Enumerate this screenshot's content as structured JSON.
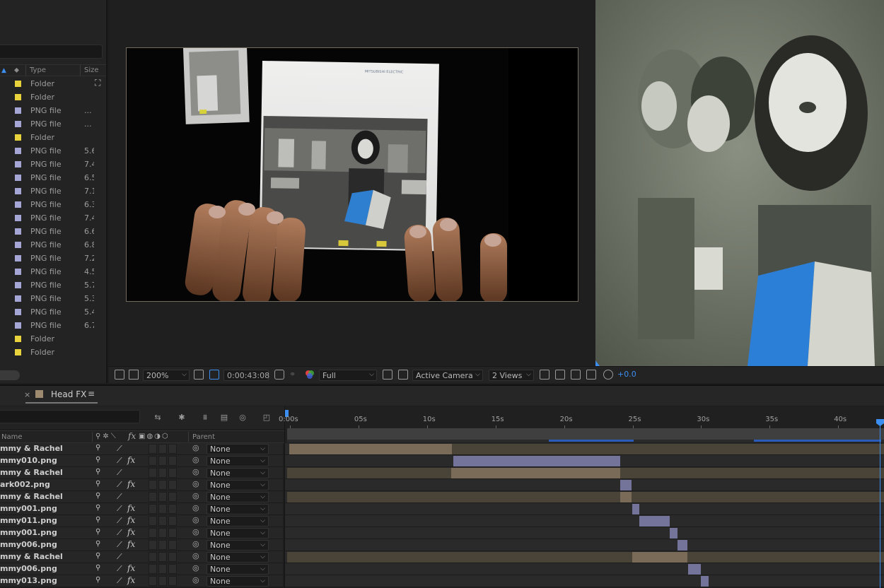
{
  "project": {
    "columns": {
      "type": "Type",
      "size": "Size"
    },
    "items": [
      {
        "type": "Folder",
        "size": "",
        "color": "#e8d33d"
      },
      {
        "type": "Folder",
        "size": "",
        "color": "#e8d33d"
      },
      {
        "type": "PNG file",
        "size": "...",
        "color": "#a6a6d6"
      },
      {
        "type": "PNG file",
        "size": "...",
        "color": "#a6a6d6"
      },
      {
        "type": "Folder",
        "size": "",
        "color": "#e8d33d"
      },
      {
        "type": "PNG file",
        "size": "5.6",
        "color": "#a6a6d6"
      },
      {
        "type": "PNG file",
        "size": "7.4",
        "color": "#a6a6d6"
      },
      {
        "type": "PNG file",
        "size": "6.5",
        "color": "#a6a6d6"
      },
      {
        "type": "PNG file",
        "size": "7.1",
        "color": "#a6a6d6"
      },
      {
        "type": "PNG file",
        "size": "6.3",
        "color": "#a6a6d6"
      },
      {
        "type": "PNG file",
        "size": "7.4",
        "color": "#a6a6d6"
      },
      {
        "type": "PNG file",
        "size": "6.6",
        "color": "#a6a6d6"
      },
      {
        "type": "PNG file",
        "size": "6.8",
        "color": "#a6a6d6"
      },
      {
        "type": "PNG file",
        "size": "7.2",
        "color": "#a6a6d6"
      },
      {
        "type": "PNG file",
        "size": "4.5",
        "color": "#a6a6d6"
      },
      {
        "type": "PNG file",
        "size": "5.7",
        "color": "#a6a6d6"
      },
      {
        "type": "PNG file",
        "size": "5.3",
        "color": "#a6a6d6"
      },
      {
        "type": "PNG file",
        "size": "5.4",
        "color": "#a6a6d6"
      },
      {
        "type": "PNG file",
        "size": "6.7",
        "color": "#a6a6d6"
      },
      {
        "type": "Folder",
        "size": "",
        "color": "#e8d33d"
      },
      {
        "type": "Folder",
        "size": "",
        "color": "#e8d33d"
      }
    ]
  },
  "viewer": {
    "frame_text": "MITSUBISHI ELECTRIC",
    "zoom": "200%",
    "timecode": "0:00:43:08",
    "resolution": "Full",
    "camera": "Active Camera",
    "views": "2 Views",
    "exposure": "+0.0"
  },
  "timeline": {
    "close": "×",
    "comp_name": "Head FX",
    "menu": "≡",
    "columns": {
      "name": "Name",
      "parent": "Parent"
    },
    "ruler": [
      "0:00s",
      "05s",
      "10s",
      "15s",
      "20s",
      "25s",
      "30s",
      "35s",
      "40s"
    ],
    "layers": [
      {
        "name": "mmy & Rachel",
        "fx": false,
        "parent": "None"
      },
      {
        "name": "mmy010.png",
        "fx": true,
        "parent": "None"
      },
      {
        "name": "mmy & Rachel",
        "fx": false,
        "parent": "None"
      },
      {
        "name": "ark002.png",
        "fx": true,
        "parent": "None"
      },
      {
        "name": "mmy & Rachel",
        "fx": false,
        "parent": "None"
      },
      {
        "name": "mmy001.png",
        "fx": true,
        "parent": "None"
      },
      {
        "name": "mmy011.png",
        "fx": true,
        "parent": "None"
      },
      {
        "name": "mmy001.png",
        "fx": true,
        "parent": "None"
      },
      {
        "name": "mmy006.png",
        "fx": true,
        "parent": "None"
      },
      {
        "name": "mmy & Rachel",
        "fx": false,
        "parent": "None"
      },
      {
        "name": "mmy006.png",
        "fx": true,
        "parent": "None"
      },
      {
        "name": "mmy013.png",
        "fx": true,
        "parent": "None"
      }
    ],
    "colors": {
      "precomp": "#7a6a58",
      "precomp_dim": "#4a4438",
      "png": "#74749a",
      "playhead": "#3c8ef0"
    }
  }
}
